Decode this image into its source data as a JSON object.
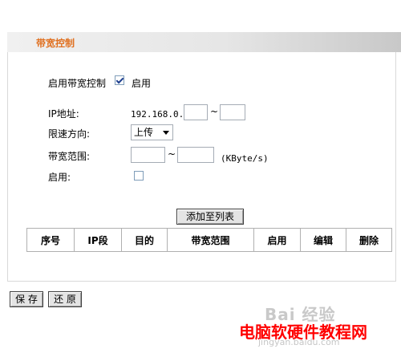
{
  "header": {
    "title": "带宽控制"
  },
  "enable_bandwidth": {
    "label": "启用带宽控制",
    "checked": true,
    "checkbox_label": "启用"
  },
  "form": {
    "ip_label": "IP地址:",
    "ip_prefix": "192.168.0.",
    "ip_sep": "~",
    "ip_start": "",
    "ip_end": "",
    "direction_label": "限速方向:",
    "direction_value": "上传",
    "range_label": "带宽范围:",
    "range_sep": "~",
    "range_min": "",
    "range_max": "",
    "range_unit": "(KByte/s)",
    "enable_label": "启用:",
    "enable_checked": false
  },
  "add_button": "添加至列表",
  "table": {
    "headers": [
      "序号",
      "IP段",
      "目的",
      "带宽范围",
      "启用",
      "编辑",
      "删除"
    ]
  },
  "footer": {
    "save": "保 存",
    "restore": "还 原"
  },
  "watermark": {
    "baidu": "Bai 经验",
    "site_cn": "电脑软硬件教程网",
    "site_url": "jingyan.baidu.com"
  },
  "colors": {
    "title": "#e07020",
    "watermark_red": "#ff0000"
  }
}
